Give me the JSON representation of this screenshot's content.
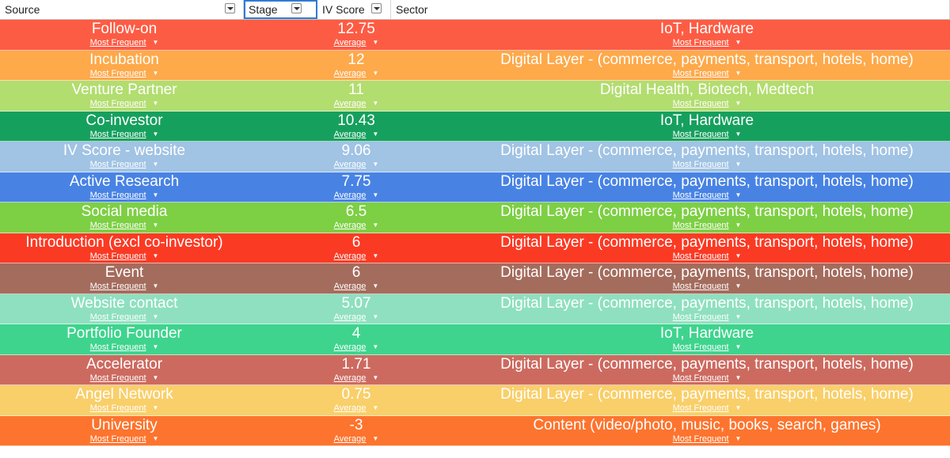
{
  "header": {
    "source_label": "Source",
    "stage_label": "Stage",
    "iv_label": "IV Score",
    "sector_label": "Sector"
  },
  "aggregations": {
    "source": "Most Frequent",
    "iv": "Average",
    "sector": "Most Frequent",
    "caret": "▼"
  },
  "rows": [
    {
      "source": "Follow-on",
      "iv": "12.75",
      "sector": "IoT, Hardware",
      "color": "#fd5c44"
    },
    {
      "source": "Incubation",
      "iv": "12",
      "sector": "Digital Layer - (commerce, payments, transport, hotels, home)",
      "color": "#fea94a"
    },
    {
      "source": "Venture Partner",
      "iv": "11",
      "sector": "Digital Health, Biotech, Medtech",
      "color": "#b2dd6f"
    },
    {
      "source": "Co-investor",
      "iv": "10.43",
      "sector": "IoT, Hardware",
      "color": "#16a05e"
    },
    {
      "source": "IV Score - website",
      "iv": "9.06",
      "sector": "Digital Layer - (commerce, payments, transport, hotels, home)",
      "color": "#a1c3e4"
    },
    {
      "source": "Active Research",
      "iv": "7.75",
      "sector": "Digital Layer - (commerce, payments, transport, hotels, home)",
      "color": "#4883e4"
    },
    {
      "source": "Social media",
      "iv": "6.5",
      "sector": "Digital Layer - (commerce, payments, transport, hotels, home)",
      "color": "#7dcf44"
    },
    {
      "source": "Introduction (excl co-investor)",
      "iv": "6",
      "sector": "Digital Layer - (commerce, payments, transport, hotels, home)",
      "color": "#fb3a24"
    },
    {
      "source": "Event",
      "iv": "6",
      "sector": "Digital Layer - (commerce, payments, transport, hotels, home)",
      "color": "#a46c5d"
    },
    {
      "source": "Website contact",
      "iv": "5.07",
      "sector": "Digital Layer - (commerce, payments, transport, hotels, home)",
      "color": "#8fe0c0"
    },
    {
      "source": "Portfolio Founder",
      "iv": "4",
      "sector": "IoT, Hardware",
      "color": "#3ed48e"
    },
    {
      "source": "Accelerator",
      "iv": "1.71",
      "sector": "Digital Layer - (commerce, payments, transport, hotels, home)",
      "color": "#cd6a60"
    },
    {
      "source": "Angel Network",
      "iv": "0.75",
      "sector": "Digital Layer - (commerce, payments, transport, hotels, home)",
      "color": "#f9cf6a"
    },
    {
      "source": "University",
      "iv": "-3",
      "sector": "Content (video/photo, music, books, search, games)",
      "color": "#fd742e"
    }
  ]
}
